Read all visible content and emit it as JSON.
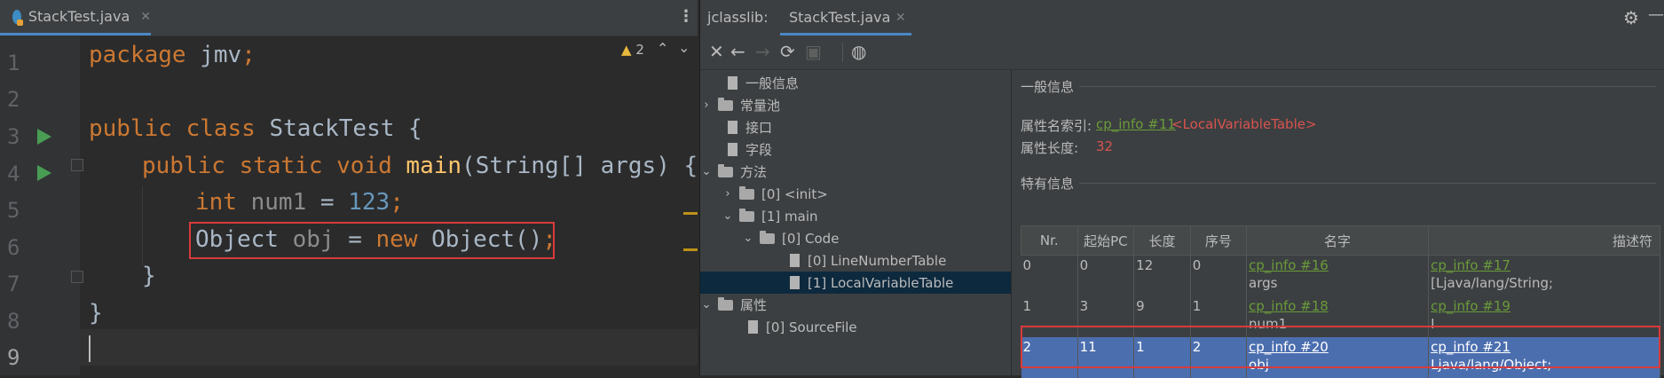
{
  "editor": {
    "tab_label": "StackTest.java",
    "warnings_count": "2",
    "line_numbers": [
      "1",
      "2",
      "3",
      "4",
      "5",
      "6",
      "7",
      "8",
      "9"
    ],
    "code": {
      "l1_kw": "package",
      "l1_rest": " jmv",
      "l1_semi": ";",
      "l3_kw": "public class",
      "l3_rest": " StackTest {",
      "l4_kw": "public static void",
      "l4_fn": " main",
      "l4_rest": "(String[] args) {",
      "l5_kw": "int",
      "l5_var": " num1",
      "l5_eq": " = ",
      "l5_num": "123",
      "l5_semi": ";",
      "l6_type": "Object",
      "l6_var": " obj",
      "l6_eq": " = ",
      "l6_kw": "new",
      "l6_rest": " Object()",
      "l6_semi": ";",
      "l7": "}",
      "l8": "}"
    }
  },
  "jclasslib": {
    "title": "jclasslib:",
    "tab_label": "StackTest.java",
    "tree": [
      {
        "label": "一般信息",
        "type": "file"
      },
      {
        "label": "常量池",
        "type": "folder",
        "expanded": false
      },
      {
        "label": "接口",
        "type": "file"
      },
      {
        "label": "字段",
        "type": "file"
      },
      {
        "label": "方法",
        "type": "folder",
        "expanded": true
      },
      {
        "label": "[0] <init>",
        "type": "folder",
        "expanded": false
      },
      {
        "label": "[1] main",
        "type": "folder",
        "expanded": true
      },
      {
        "label": "[0] Code",
        "type": "folder",
        "expanded": true
      },
      {
        "label": "[0] LineNumberTable",
        "type": "file"
      },
      {
        "label": "[1] LocalVariableTable",
        "type": "file",
        "selected": true
      },
      {
        "label": "属性",
        "type": "folder",
        "expanded": true
      },
      {
        "label": "[0] SourceFile",
        "type": "file"
      }
    ],
    "detail": {
      "general_title": "一般信息",
      "attr_name_label": "属性名索引:",
      "attr_name_link": "cp_info #11",
      "attr_name_value": "<LocalVariableTable>",
      "attr_len_label": "属性长度:",
      "attr_len_value": "32",
      "specific_title": "特有信息",
      "table": {
        "headers": [
          "Nr.",
          "起始PC",
          "长度",
          "序号",
          "名字",
          "描述符"
        ],
        "rows": [
          {
            "nr": "0",
            "pc": "0",
            "len": "12",
            "idx": "0",
            "name_link": "cp_info #16",
            "name": "args",
            "desc_link": "cp_info #17",
            "desc": "[Ljava/lang/String;"
          },
          {
            "nr": "1",
            "pc": "3",
            "len": "9",
            "idx": "1",
            "name_link": "cp_info #18",
            "name": "num1",
            "desc_link": "cp_info #19",
            "desc": "I"
          },
          {
            "nr": "2",
            "pc": "11",
            "len": "1",
            "idx": "2",
            "name_link": "cp_info #20",
            "name": "obj",
            "desc_link": "cp_info #21",
            "desc": "Ljava/lang/Object;"
          }
        ]
      }
    }
  },
  "colors": {
    "accent": "#4a88c7",
    "highlight_box": "#d93b3b",
    "selected_row": "#4b6eaf"
  }
}
